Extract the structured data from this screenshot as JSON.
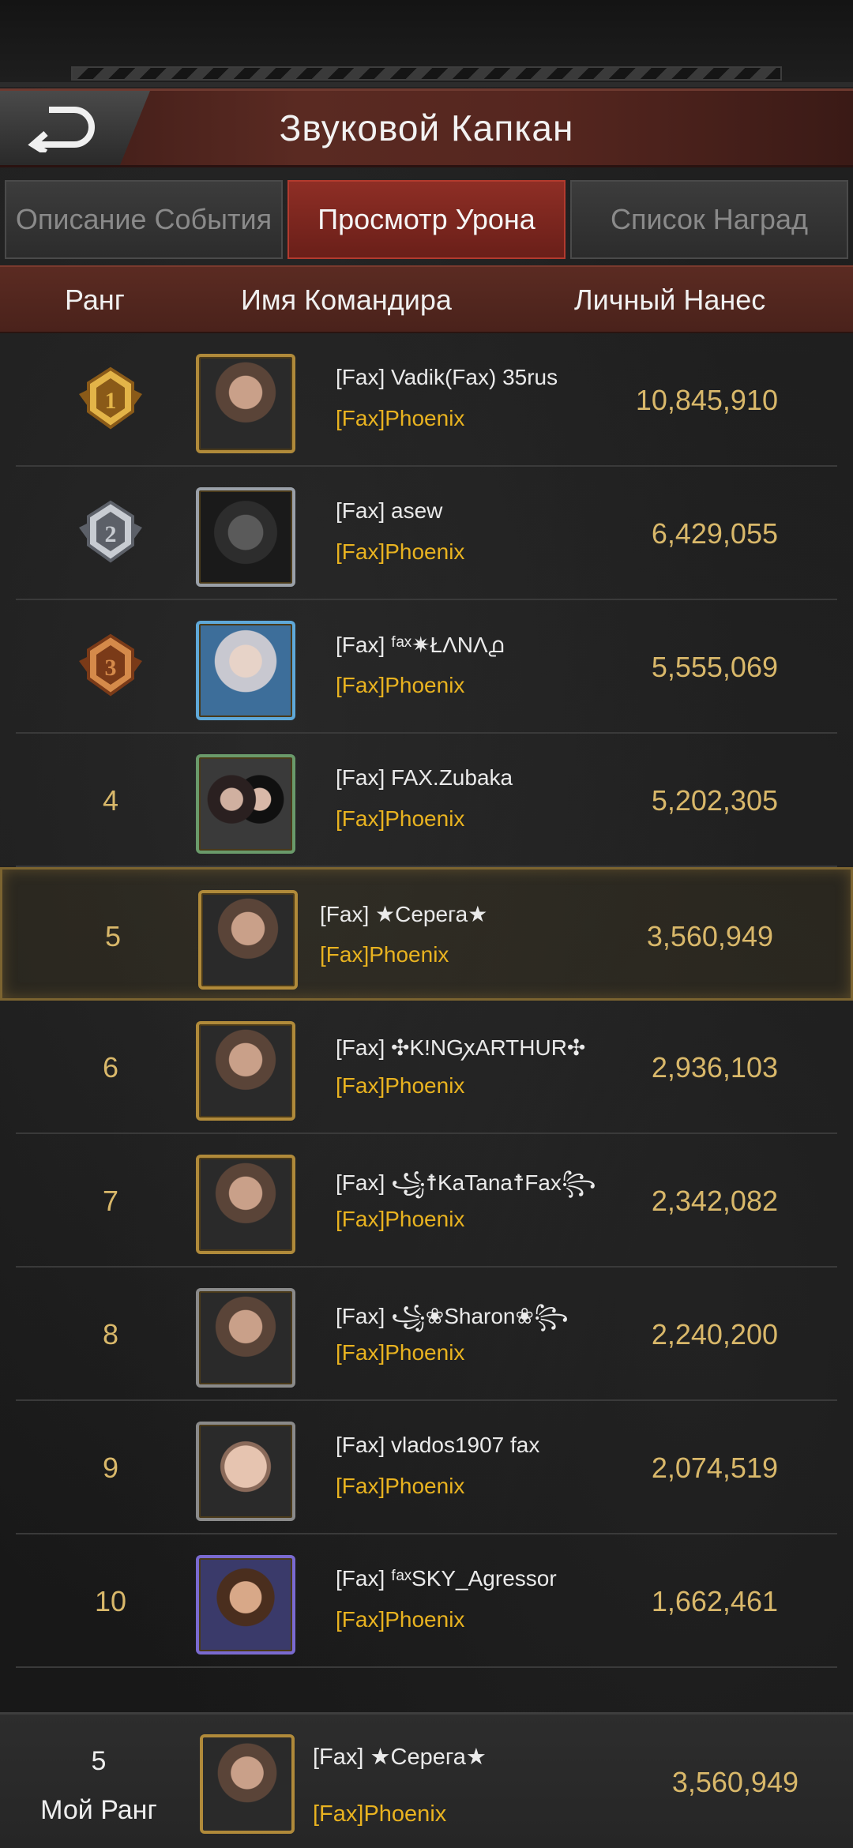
{
  "header": {
    "title": "Звуковой Капкан",
    "back_icon": "back-arrow-icon"
  },
  "tabs": [
    {
      "label": "Описание События",
      "active": false
    },
    {
      "label": "Просмотр Урона",
      "active": true
    },
    {
      "label": "Список Наград",
      "active": false
    }
  ],
  "table": {
    "col_rank": "Ранг",
    "col_name": "Имя Командира",
    "col_damage": "Личный Нанес"
  },
  "rows": [
    {
      "rank": "1",
      "medal": "gold",
      "name": "[Fax] Vadik(Fax) 35rus",
      "guild": "[Fax]Phoenix",
      "damage": "10,845,910",
      "avatar": "gold-frame"
    },
    {
      "rank": "2",
      "medal": "silver",
      "name": "[Fax] asew",
      "guild": "[Fax]Phoenix",
      "damage": "6,429,055",
      "avatar": "silver-frame"
    },
    {
      "rank": "3",
      "medal": "bronze",
      "name": "[Fax] ᶠᵃˣ✷ŁΛNΛ൧",
      "guild": "[Fax]Phoenix",
      "damage": "5,555,069",
      "avatar": "blue-frame"
    },
    {
      "rank": "4",
      "medal": "",
      "name": "[Fax] FAX.Zubaka",
      "guild": "[Fax]Phoenix",
      "damage": "5,202,305",
      "avatar": "green-frame"
    },
    {
      "rank": "5",
      "medal": "",
      "name": "[Fax] ★Серега★",
      "guild": "[Fax]Phoenix",
      "damage": "3,560,949",
      "avatar": "gold-frame",
      "highlight": true
    },
    {
      "rank": "6",
      "medal": "",
      "name": "[Fax] ✣K!NGꭗARTHUR✣",
      "guild": "[Fax]Phoenix",
      "damage": "2,936,103",
      "avatar": "gold-frame"
    },
    {
      "rank": "7",
      "medal": "",
      "name": "[Fax] ꧁☨KaTana☨Fax꧂",
      "guild": "[Fax]Phoenix",
      "damage": "2,342,082",
      "avatar": "gold-frame"
    },
    {
      "rank": "8",
      "medal": "",
      "name": "[Fax] ꧁❀Sharon❀꧂",
      "guild": "[Fax]Phoenix",
      "damage": "2,240,200",
      "avatar": "plain-frame"
    },
    {
      "rank": "9",
      "medal": "",
      "name": "[Fax] vlados1907 fax",
      "guild": "[Fax]Phoenix",
      "damage": "2,074,519",
      "avatar": "plain-frame"
    },
    {
      "rank": "10",
      "medal": "",
      "name": "[Fax] ᶠᵃˣSKY_Agressor",
      "guild": "[Fax]Phoenix",
      "damage": "1,662,461",
      "avatar": "purple-frame"
    }
  ],
  "my_rank": {
    "rank": "5",
    "label": "Мой Ранг",
    "name": "[Fax] ★Серега★",
    "guild": "[Fax]Phoenix",
    "damage": "3,560,949"
  },
  "colors": {
    "accent_red": "#8e2e25",
    "gold_text": "#d9b86a",
    "guild_yellow": "#e9b320"
  }
}
